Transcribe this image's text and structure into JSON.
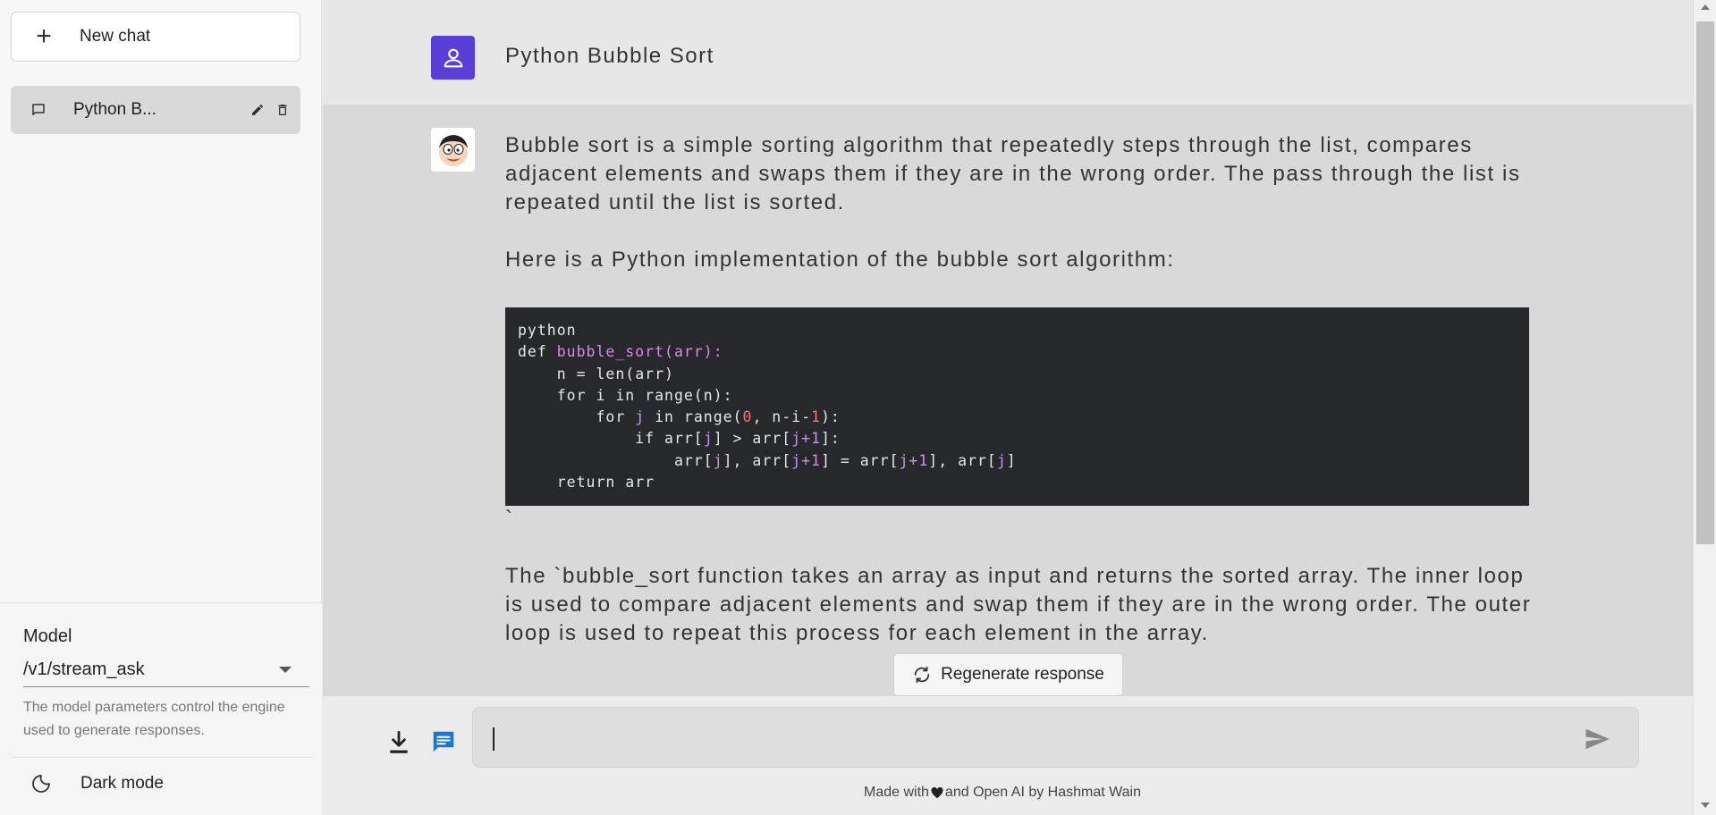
{
  "sidebar": {
    "new_chat_label": "New chat",
    "chats": [
      {
        "label": "Python B..."
      }
    ],
    "model_label": "Model",
    "model_value": "/v1/stream_ask",
    "model_help": "The model parameters control the engine used to generate responses.",
    "dark_mode_label": "Dark mode"
  },
  "conversation": {
    "question": "Python Bubble Sort",
    "answer_p1": "Bubble sort is a simple sorting algorithm that repeatedly steps through the list, compares adjacent elements and swaps them if they are in the wrong order. The pass through the list is repeated until the list is sorted.",
    "answer_p2": "Here is a Python implementation of the bubble sort algorithm:",
    "code_lines": [
      "python",
      "def bubble_sort(arr):",
      "    n = len(arr)",
      "    for i in range(n):",
      "        for j in range(0, n-i-1):",
      "            if arr[j] > arr[j+1]:",
      "                arr[j], arr[j+1] = arr[j+1], arr[j]",
      "    return arr"
    ],
    "code_trailer": "`",
    "answer_p3": "The `bubble_sort function takes an array as input and returns the sorted array. The inner loop is used to compare adjacent elements and swap them if they are in the wrong order. The outer loop is used to repeat this process for each element in the array."
  },
  "regenerate_label": "Regenerate response",
  "input": {
    "value": "",
    "placeholder": ""
  },
  "footer": {
    "prefix": "Made with",
    "suffix": " and Open AI by Hashmat Wain"
  },
  "colors": {
    "user_avatar": "#5a3fd6",
    "message_icon": "#1976d2",
    "code_bg": "#27282b"
  }
}
